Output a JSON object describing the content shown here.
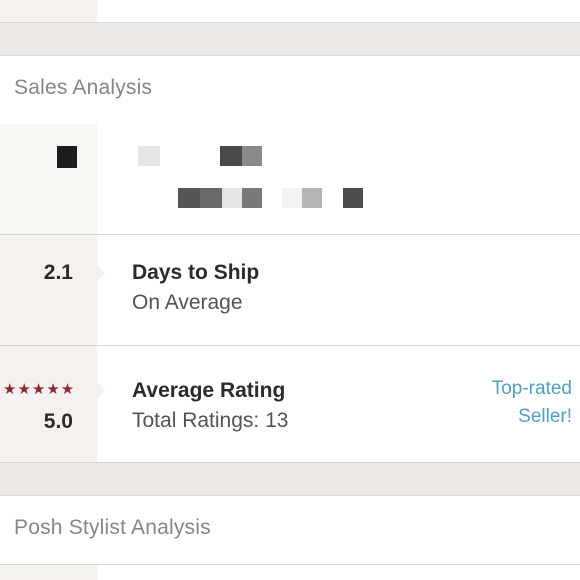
{
  "sales_analysis": {
    "title": "Sales Analysis"
  },
  "days_to_ship": {
    "value": "2.1",
    "title": "Days to Ship",
    "subtitle": "On Average"
  },
  "average_rating": {
    "stars": "★★★★★",
    "value": "5.0",
    "title": "Average Rating",
    "subtitle": "Total Ratings: 13",
    "badge_line1": "Top-rated",
    "badge_line2": "Seller!"
  },
  "stylist_analysis": {
    "title": "Posh Stylist Analysis"
  },
  "colors": {
    "accent_link": "#4aa2c4",
    "star_color": "#8a2a34",
    "background": "#ece8e3"
  }
}
